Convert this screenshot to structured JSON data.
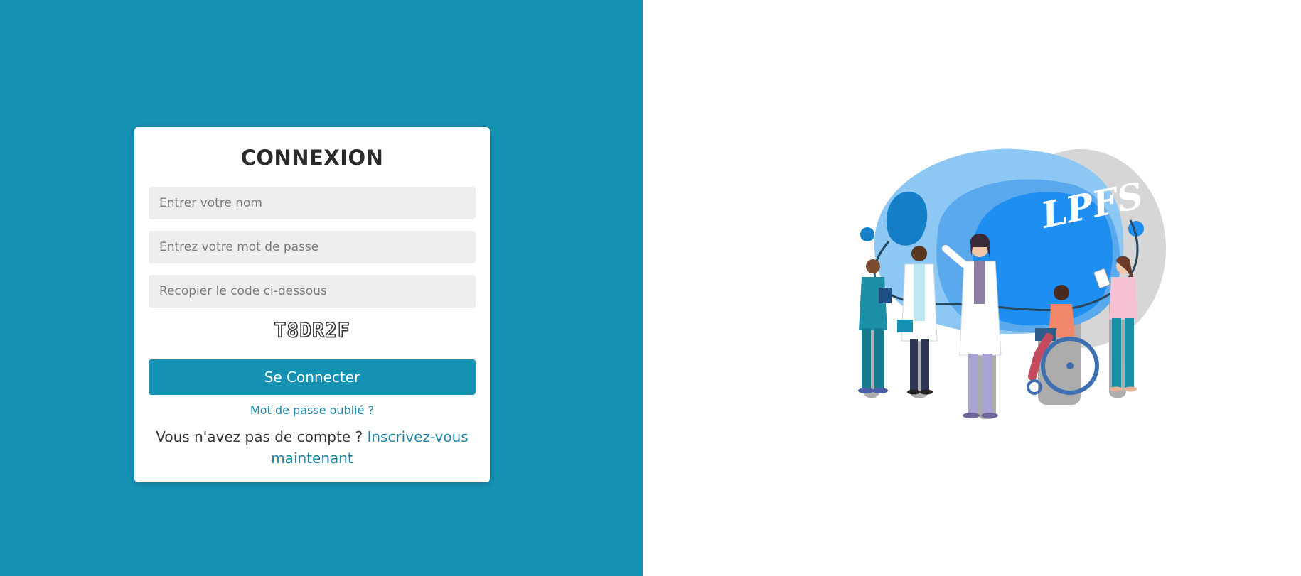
{
  "login": {
    "title": "CONNEXION",
    "name_placeholder": "Entrer votre nom",
    "password_placeholder": "Entrez votre mot de passe",
    "code_placeholder": "Recopier le code ci-dessous",
    "captcha_code": "T8DR2F",
    "submit_label": "Se Connecter",
    "forgot_password": "Mot de passe oublié ?",
    "no_account_text": "Vous n'avez pas de compte ?",
    "signup_link": "Inscrivez-vous maintenant"
  },
  "illustration": {
    "logo_text": "LPFS"
  },
  "colors": {
    "primary": "#1591b1",
    "link": "#1b86a8",
    "field_bg": "#eeeeee",
    "title": "#2b2b2b"
  }
}
